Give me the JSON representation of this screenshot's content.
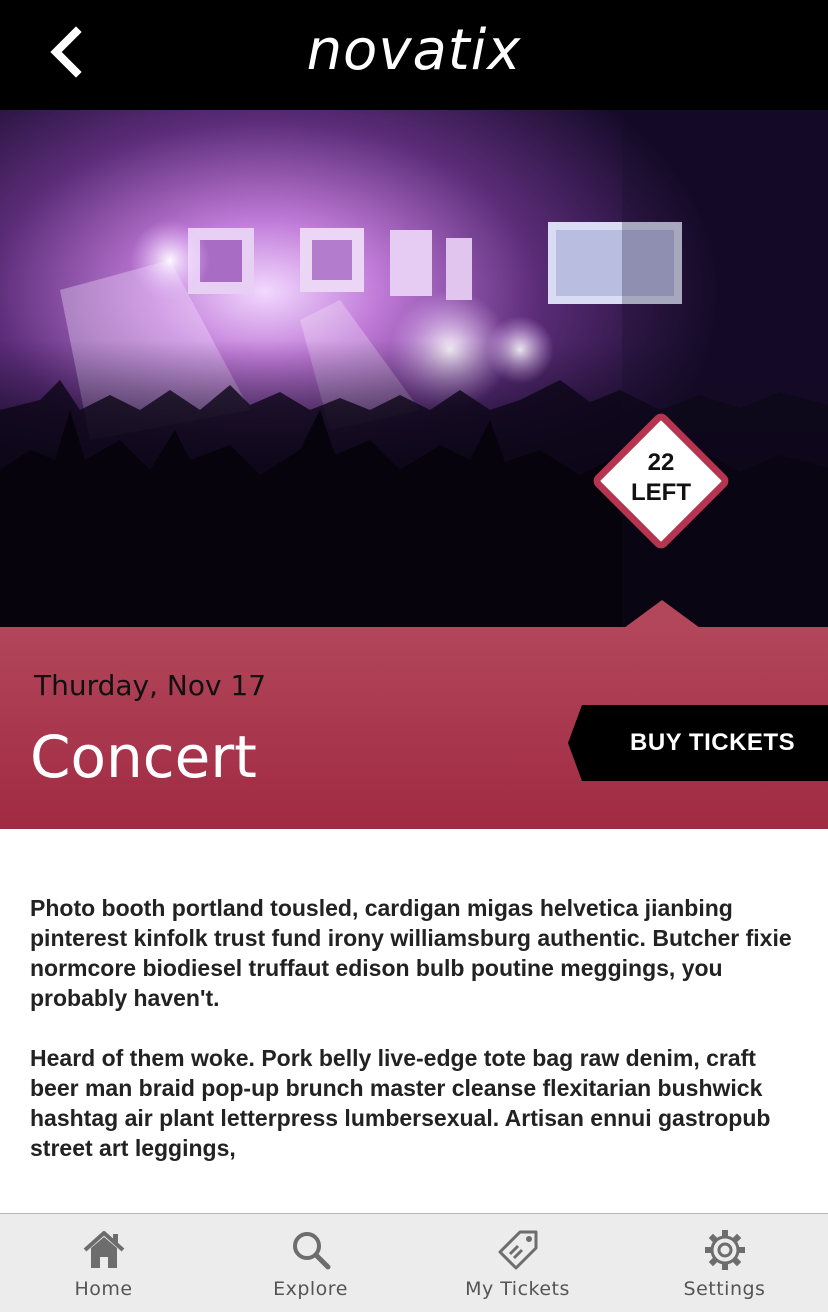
{
  "app": {
    "logo_text": "novatix"
  },
  "header": {
    "back_icon": "chevron-left-icon"
  },
  "hero": {
    "image": "concert-crowd-photo"
  },
  "badge": {
    "line1": "22",
    "line2": "LEFT"
  },
  "event": {
    "date": "Thurday, Nov 17",
    "title": "Concert",
    "buy_label": "BUY TICKETS"
  },
  "description": {
    "paragraphs": [
      "Photo booth portland tousled, cardigan migas helvetica jianbing pinterest kinfolk trust fund irony williamsburg authentic. Butcher fixie normcore biodiesel truffaut edison bulb poutine meggings, you probably haven't.",
      "Heard of them woke. Pork belly live-edge tote bag raw denim, craft beer man braid pop-up brunch master cleanse flexitarian bushwick hashtag air plant letterpress lumbersexual. Artisan ennui gastropub street art leggings,"
    ]
  },
  "nav": {
    "items": [
      {
        "label": "Home",
        "icon": "home-icon"
      },
      {
        "label": "Explore",
        "icon": "search-icon"
      },
      {
        "label": "My Tickets",
        "icon": "ticket-tag-icon"
      },
      {
        "label": "Settings",
        "icon": "gear-icon"
      }
    ]
  },
  "colors": {
    "accent": "#a8324b",
    "header_bg": "#000000",
    "nav_bg": "#ececec"
  }
}
